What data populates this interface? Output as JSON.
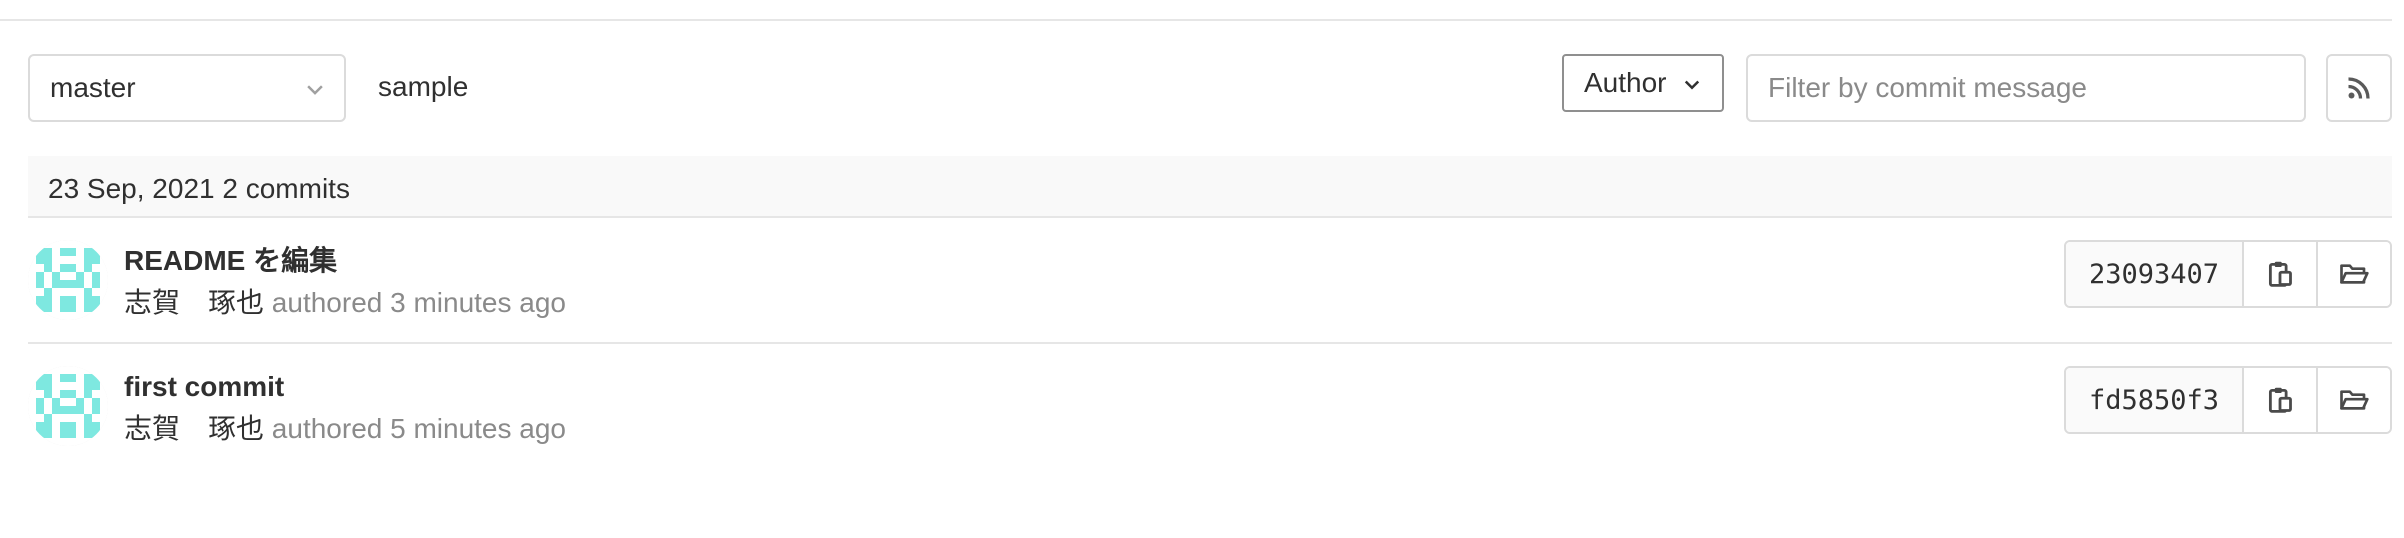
{
  "toolbar": {
    "branch": "master",
    "path": "sample",
    "author_label": "Author",
    "filter": {
      "placeholder": "Filter by commit message",
      "value": ""
    },
    "rss_icon": "rss-icon"
  },
  "day_group": {
    "label": "23 Sep, 2021 2 commits"
  },
  "commits": [
    {
      "title": "README を編集",
      "author": "志賀　琢也",
      "authored_text": "authored 3 minutes ago",
      "sha": "23093407",
      "copy_icon": "clipboard-icon",
      "browse_icon": "folder-open-icon"
    },
    {
      "title": "first commit",
      "author": "志賀　琢也",
      "authored_text": "authored 5 minutes ago",
      "sha": "fd5850f3",
      "copy_icon": "clipboard-icon",
      "browse_icon": "folder-open-icon"
    }
  ],
  "colors": {
    "avatar_identicon": "#7ee8e0",
    "border": "#dbdbdb",
    "muted_text": "#8a8a8a",
    "header_bg": "#f9f9f9"
  }
}
